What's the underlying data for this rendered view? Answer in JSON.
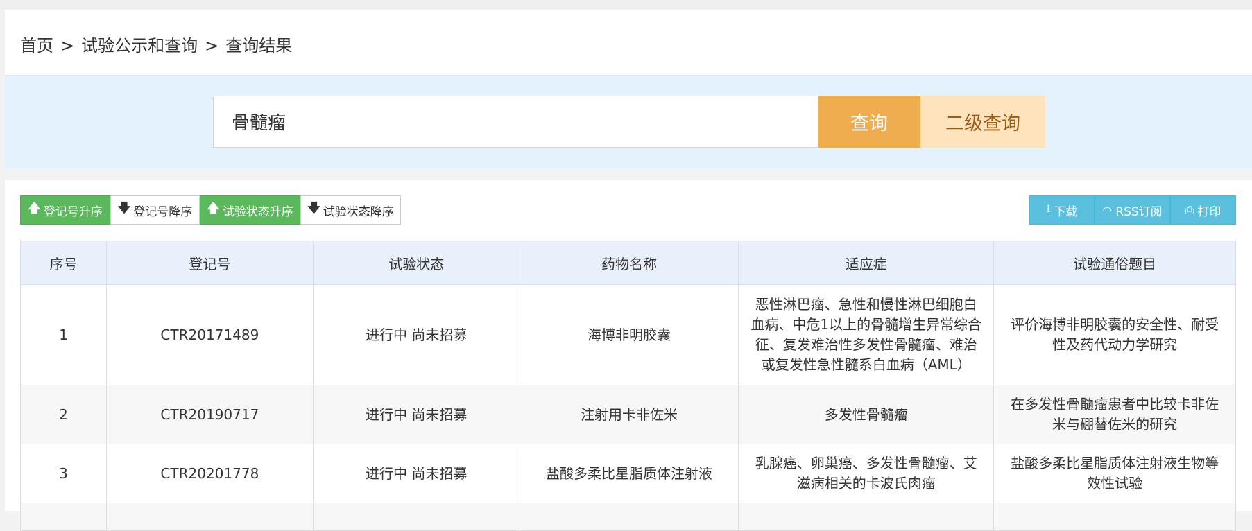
{
  "breadcrumb": {
    "home": "首页",
    "sep": ">",
    "level2": "试验公示和查询",
    "level3": "查询结果"
  },
  "search": {
    "value": "骨髓瘤",
    "query_label": "查询",
    "secondary_query_label": "二级查询"
  },
  "sort_buttons": [
    {
      "label": "登记号升序",
      "icon": "arrow-up-icon",
      "active": true
    },
    {
      "label": "登记号降序",
      "icon": "arrow-down-icon",
      "active": false
    },
    {
      "label": "试验状态升序",
      "icon": "arrow-up-icon",
      "active": true
    },
    {
      "label": "试验状态降序",
      "icon": "arrow-down-icon",
      "active": false
    }
  ],
  "actions": [
    {
      "label": "下载",
      "icon": "download-icon"
    },
    {
      "label": "RSS订阅",
      "icon": "rss-icon"
    },
    {
      "label": "打印",
      "icon": "print-icon"
    }
  ],
  "table": {
    "headers": [
      "序号",
      "登记号",
      "试验状态",
      "药物名称",
      "适应症",
      "试验通俗题目"
    ],
    "rows": [
      {
        "index": "1",
        "reg_no": "CTR20171489",
        "status": "进行中 尚未招募",
        "drug": "海博非明胶囊",
        "indication": "恶性淋巴瘤、急性和慢性淋巴细胞白血病、中危1以上的骨髓增生异常综合征、复发难治性多发性骨髓瘤、难治或复发性急性髓系白血病（AML）",
        "title": "评价海博非明胶囊的安全性、耐受性及药代动力学研究"
      },
      {
        "index": "2",
        "reg_no": "CTR20190717",
        "status": "进行中 尚未招募",
        "drug": "注射用卡非佐米",
        "indication": "多发性骨髓瘤",
        "title": "在多发性骨髓瘤患者中比较卡非佐米与硼替佐米的研究"
      },
      {
        "index": "3",
        "reg_no": "CTR20201778",
        "status": "进行中 尚未招募",
        "drug": "盐酸多柔比星脂质体注射液",
        "indication": "乳腺癌、卵巢癌、多发性骨髓瘤、艾滋病相关的卡波氏肉瘤",
        "title": "盐酸多柔比星脂质体注射液生物等效性试验"
      }
    ]
  }
}
